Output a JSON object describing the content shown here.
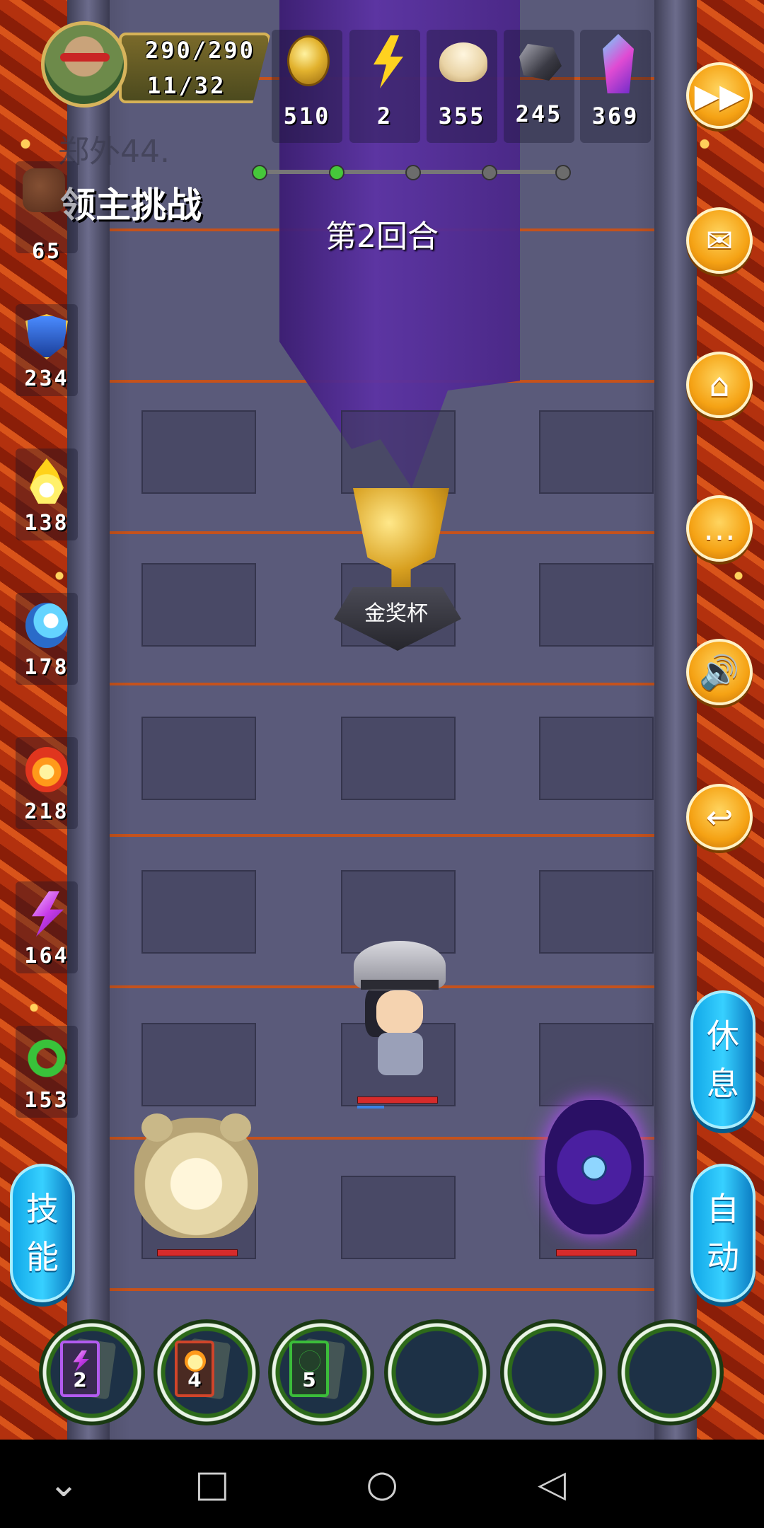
{
  "player": {
    "hp": "290/290",
    "level_progress": "11/32"
  },
  "resources": [
    {
      "icon": "gold-coin-icon",
      "value": "510"
    },
    {
      "icon": "energy-bolt-icon",
      "value": "2"
    },
    {
      "icon": "bun-icon",
      "value": "355"
    },
    {
      "icon": "iron-ore-icon",
      "value": "245"
    },
    {
      "icon": "crystal-icon",
      "value": "369"
    }
  ],
  "level_name": "郑外44.",
  "mode_title": "领主挑战",
  "round_text": "第2回合",
  "stats": [
    {
      "icon": "fist-icon",
      "value": "65"
    },
    {
      "icon": "shield-icon",
      "value": "234"
    },
    {
      "icon": "holy-flame-icon",
      "value": "138"
    },
    {
      "icon": "water-wave-icon",
      "value": "178"
    },
    {
      "icon": "fire-icon",
      "value": "218"
    },
    {
      "icon": "lightning-icon",
      "value": "164"
    },
    {
      "icon": "poison-icon",
      "value": "153"
    }
  ],
  "right_buttons": [
    {
      "icon": "fast-forward-icon",
      "glyph": "▶▶"
    },
    {
      "icon": "mail-icon",
      "glyph": "✉"
    },
    {
      "icon": "home-icon",
      "glyph": "⌂"
    },
    {
      "icon": "chat-icon",
      "glyph": "…"
    },
    {
      "icon": "sound-icon",
      "glyph": "🔊"
    },
    {
      "icon": "return-icon",
      "glyph": "↩"
    }
  ],
  "rest_button": [
    "休",
    "息"
  ],
  "auto_button": [
    "自",
    "动"
  ],
  "skill_button": [
    "技",
    "能"
  ],
  "trophy_label": "金奖杯",
  "progress": {
    "total": 5,
    "completed": 2
  },
  "skill_slots": [
    {
      "count": "2",
      "color": "#b35bf0",
      "element": "lightning"
    },
    {
      "count": "4",
      "color": "#d0452a",
      "element": "fire"
    },
    {
      "count": "5",
      "color": "#3bbd3a",
      "element": "poison"
    },
    {
      "count": "",
      "color": "",
      "element": "empty"
    },
    {
      "count": "",
      "color": "",
      "element": "empty"
    },
    {
      "count": "",
      "color": "",
      "element": "empty"
    }
  ],
  "nav": [
    {
      "icon": "chevron-down-icon",
      "glyph": "⌄"
    },
    {
      "icon": "recent-apps-icon",
      "glyph": "□"
    },
    {
      "icon": "home-nav-icon",
      "glyph": "○"
    },
    {
      "icon": "back-icon",
      "glyph": "◁"
    }
  ]
}
